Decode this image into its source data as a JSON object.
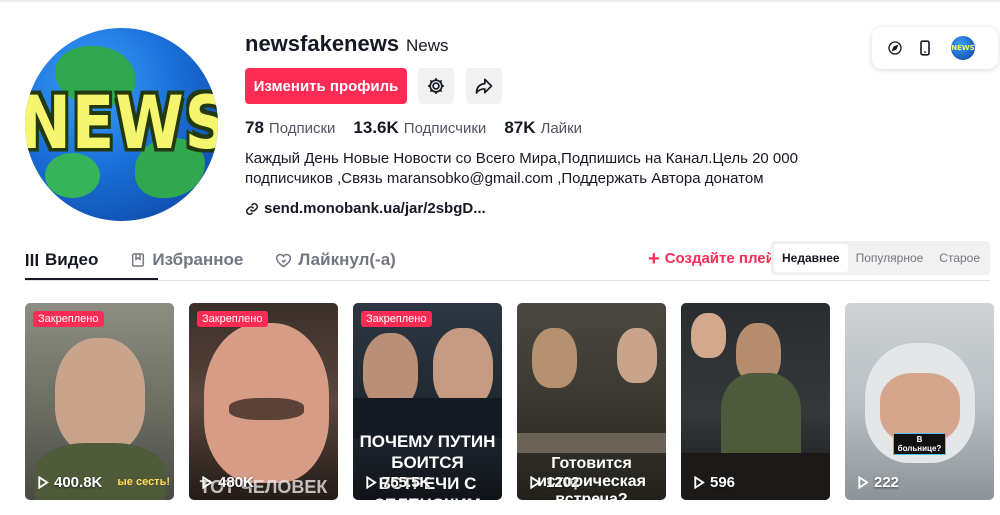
{
  "profile": {
    "username": "newsfakenews",
    "nickname": "News",
    "avatar_text": "NEWS",
    "edit_button": "Изменить профиль",
    "stats": [
      {
        "num": "78",
        "label": "Подписки"
      },
      {
        "num": "13.6K",
        "label": "Подписчики"
      },
      {
        "num": "87K",
        "label": "Лайки"
      }
    ],
    "bio_line1": "Каждый День Новые Новости со Всего Мира,Подпишись на Канал.Цель 20 000",
    "bio_line2": "подписчиков ,Связь maransobko@gmail.com ,Поддержать Автора донатом",
    "link": "send.monobank.ua/jar/2sbgD..."
  },
  "top_right": {
    "mini_avatar_text": "NEWS",
    "icons": [
      "compass-icon",
      "phone-icon"
    ]
  },
  "tabs": [
    {
      "label": "Видео",
      "icon": "grid-icon",
      "active": true
    },
    {
      "label": "Избранное",
      "icon": "bookmark-icon",
      "active": false
    },
    {
      "label": "Лайкнул(-а)",
      "icon": "heart-icon",
      "active": false
    }
  ],
  "create_playlist": "Создайте плейлист",
  "sort_options": [
    {
      "label": "Недавнее",
      "active": true
    },
    {
      "label": "Популярное",
      "active": false
    },
    {
      "label": "Старое",
      "active": false
    }
  ],
  "videos": [
    {
      "pinned": "Закреплено",
      "views": "400.8K",
      "caption": "ые сесть!"
    },
    {
      "pinned": "Закреплено",
      "views": "480K",
      "caption": "ТОТ ЧЕЛОВЕК"
    },
    {
      "pinned": "Закреплено",
      "views": "755.5K",
      "caption": "ПОЧЕМУ ПУТИН БОИТСЯ ВСТРЕЧИ С ЗЕЛЕНСКИМ"
    },
    {
      "pinned": "",
      "views": "1202",
      "caption": "Готовится историческая встреча?"
    },
    {
      "pinned": "",
      "views": "596",
      "caption": ""
    },
    {
      "pinned": "",
      "views": "222",
      "caption": "В больнице?"
    }
  ],
  "colors": {
    "accent": "#fe2c55",
    "text": "#161823",
    "muted": "#737680"
  }
}
